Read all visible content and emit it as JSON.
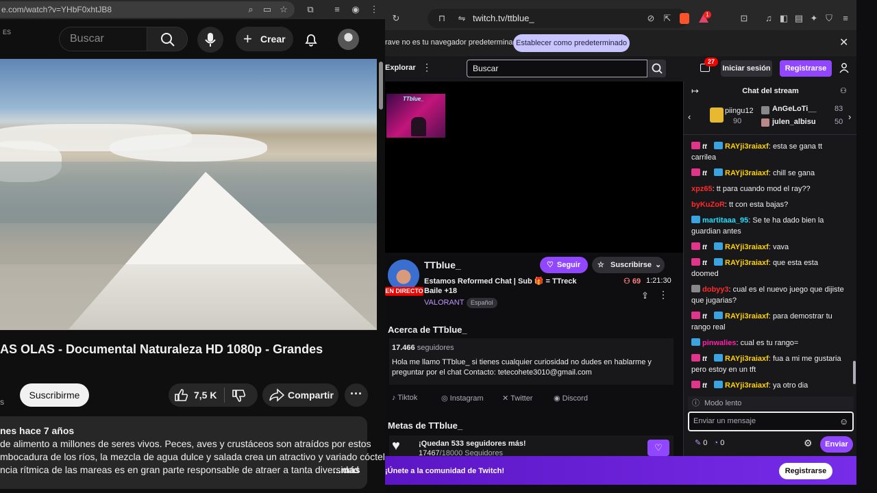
{
  "youtube": {
    "url": "e.com/watch?v=YHbF0xhtJB8",
    "country": "ES",
    "search_placeholder": "Buscar",
    "create_label": "Crear",
    "video_title": "AS OLAS - Documental Naturaleza HD 1080p - Grandes",
    "channel_suffix": "s",
    "subscribe_label": "Suscribirme",
    "likes": "7,5 K",
    "share_label": "Compartir",
    "desc_meta": "nes  hace 7 años",
    "desc_lines": [
      " de alimento a millones de seres vivos. Peces, aves y crustáceos son atraídos por estos",
      "mbocadura de los ríos, la mezcla de agua dulce y salada crea un atractivo y variado cóctel,",
      "ncia rítmica de las mareas es en gran parte responsable de atraer a tanta diversidad"
    ],
    "more_label": "...más"
  },
  "twitch": {
    "url": "twitch.tv/ttblue_",
    "infobar_text": "rave no es tu navegador predeterminado",
    "infobar_button": "Establecer como predeterminado",
    "explore_label": "Explorar",
    "search_placeholder": "Buscar",
    "notif_count": "27",
    "brave_count": "1",
    "login_label": "Iniciar sesión",
    "register_label": "Registrarse",
    "stream_logo_text": "TTblue_",
    "channel_name": "TTblue_",
    "follow_label": "Seguir",
    "subscribe_label": "Suscribirse",
    "stream_title_1": "Estamos Reformed Chat | Sub",
    "stream_title_gift": "= TTreck",
    "stream_title_2": "Baile +18",
    "viewers": "69",
    "uptime": "1:21:30",
    "live_label": "EN DIRECTO",
    "game": "VALORANT",
    "language": "Español",
    "about_heading": "Acerca de TTblue_",
    "followers_count": "17.466",
    "followers_label": "seguidores",
    "bio": "Hola me llamo TTblue_ si tienes cualquier curiosidad no dudes en hablarme y preguntar por el chat Contacto: tetecohete3010@gmail.com",
    "socials": [
      "Tiktok",
      "Instagram",
      "Twitter",
      "Discord"
    ],
    "goals_heading": "Metas de TTblue_",
    "goal_title": "¡Quedan 533 seguidores más!",
    "goal_current": "17467",
    "goal_rest": "/18000 Seguidores",
    "join_text": "¡Únete a la comunidad de Twitch!",
    "join_button": "Registrarse"
  },
  "chat": {
    "title": "Chat del stream",
    "gifters": [
      {
        "name": "piingu12",
        "count": "90"
      },
      {
        "name": "AnGeLoTi__",
        "count": "83"
      },
      {
        "name": "julen_albisu",
        "count": "50"
      }
    ],
    "messages": [
      {
        "user": "RAYji3raiaxf",
        "color": "#ffd200",
        "badges": "htc",
        "text": "esta se gana tt carrilea"
      },
      {
        "user": "RAYji3raiaxf",
        "color": "#ffd200",
        "badges": "htc",
        "text": "chill se gana"
      },
      {
        "user": "xpz65",
        "color": "#ff2a2a",
        "badges": "",
        "text": "tt para cuando mod el ray??"
      },
      {
        "user": "byKuZoR",
        "color": "#ff2a2a",
        "badges": "",
        "text": "tt con esta bajas?"
      },
      {
        "user": "martitaaa_95",
        "color": "#1ee0ff",
        "badges": "c",
        "text": "Se te ha dado bien la guardian antes"
      },
      {
        "user": "RAYji3raiaxf",
        "color": "#ffd200",
        "badges": "htc",
        "text": "vava"
      },
      {
        "user": "RAYji3raiaxf",
        "color": "#ffd200",
        "badges": "htc",
        "text": "que esta esta doomed"
      },
      {
        "user": "dobyy3",
        "color": "#ff2a2a",
        "badges": "g",
        "text": "cual es el nuevo juego que dijiste que jugarias?"
      },
      {
        "user": "RAYji3raiaxf",
        "color": "#ffd200",
        "badges": "htc",
        "text": "para demostrar tu rango real"
      },
      {
        "user": "pinwalies",
        "color": "#ff1fa8",
        "badges": "c",
        "text": "cual es tu rango="
      },
      {
        "user": "RAYji3raiaxf",
        "color": "#ffd200",
        "badges": "htc",
        "text": "fua a mi me gustaria pero estoy en un tft"
      },
      {
        "user": "RAYji3raiaxf",
        "color": "#ffd200",
        "badges": "htc",
        "text": "ya otro dia"
      }
    ],
    "slow_mode": "Modo lento",
    "input_placeholder": "Enviar un mensaje",
    "points_1": "0",
    "points_2": "0",
    "send_label": "Enviar"
  },
  "colors": {
    "twitch_purple": "#9147ff",
    "youtube_bg": "#0f0f0f",
    "twitch_bg": "#0e0e10"
  }
}
